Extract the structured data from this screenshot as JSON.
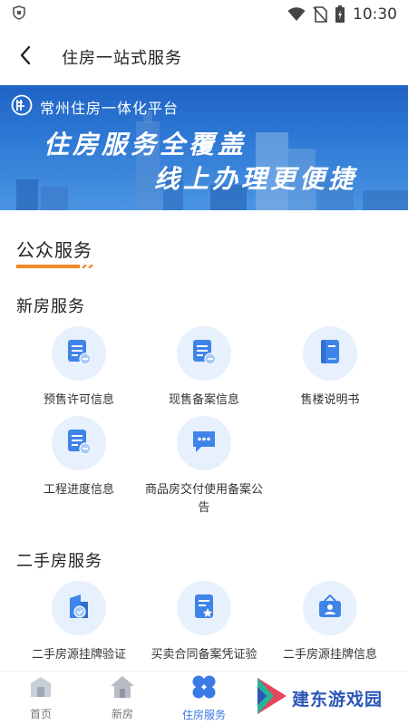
{
  "status_bar": {
    "time": "10:30",
    "icons": [
      "shield-icon",
      "wifi-icon",
      "no-sim-icon",
      "battery-icon"
    ]
  },
  "header": {
    "back_icon": "chevron-left-icon",
    "title": "住房一站式服务"
  },
  "banner": {
    "platform_name": "常州住房一体化平台",
    "slogan_line1": "住房服务全覆盖",
    "slogan_line2": "线上办理更便捷"
  },
  "public_services": {
    "title": "公众服务",
    "accent_color": "#f08a24"
  },
  "new_house": {
    "title": "新房服务",
    "items": [
      {
        "label": "预售许可信息",
        "icon": "document-certificate-icon"
      },
      {
        "label": "现售备案信息",
        "icon": "document-certificate-icon"
      },
      {
        "label": "售楼说明书",
        "icon": "book-icon"
      },
      {
        "label": "工程进度信息",
        "icon": "document-certificate-icon"
      },
      {
        "label": "商品房交付使用备案公告",
        "icon": "chat-bubble-icon"
      }
    ]
  },
  "second_hand": {
    "title": "二手房服务",
    "items": [
      {
        "label": "二手房源挂牌验证",
        "icon": "building-certificate-icon"
      },
      {
        "label": "买卖合同备案凭证验",
        "icon": "document-star-icon"
      },
      {
        "label": "二手房源挂牌信息",
        "icon": "hanging-sign-icon"
      }
    ]
  },
  "bottom_nav": {
    "items": [
      {
        "label": "首页",
        "icon": "home-building-icon",
        "active": false
      },
      {
        "label": "新房",
        "icon": "house-icon",
        "active": false
      },
      {
        "label": "住房服务",
        "icon": "grid-circles-icon",
        "active": true
      }
    ]
  },
  "watermark": {
    "text": "建东游戏园"
  },
  "colors": {
    "primary": "#3b7be6",
    "icon_bg": "#e7f0fd",
    "banner_blue": "#2f7ad6"
  }
}
